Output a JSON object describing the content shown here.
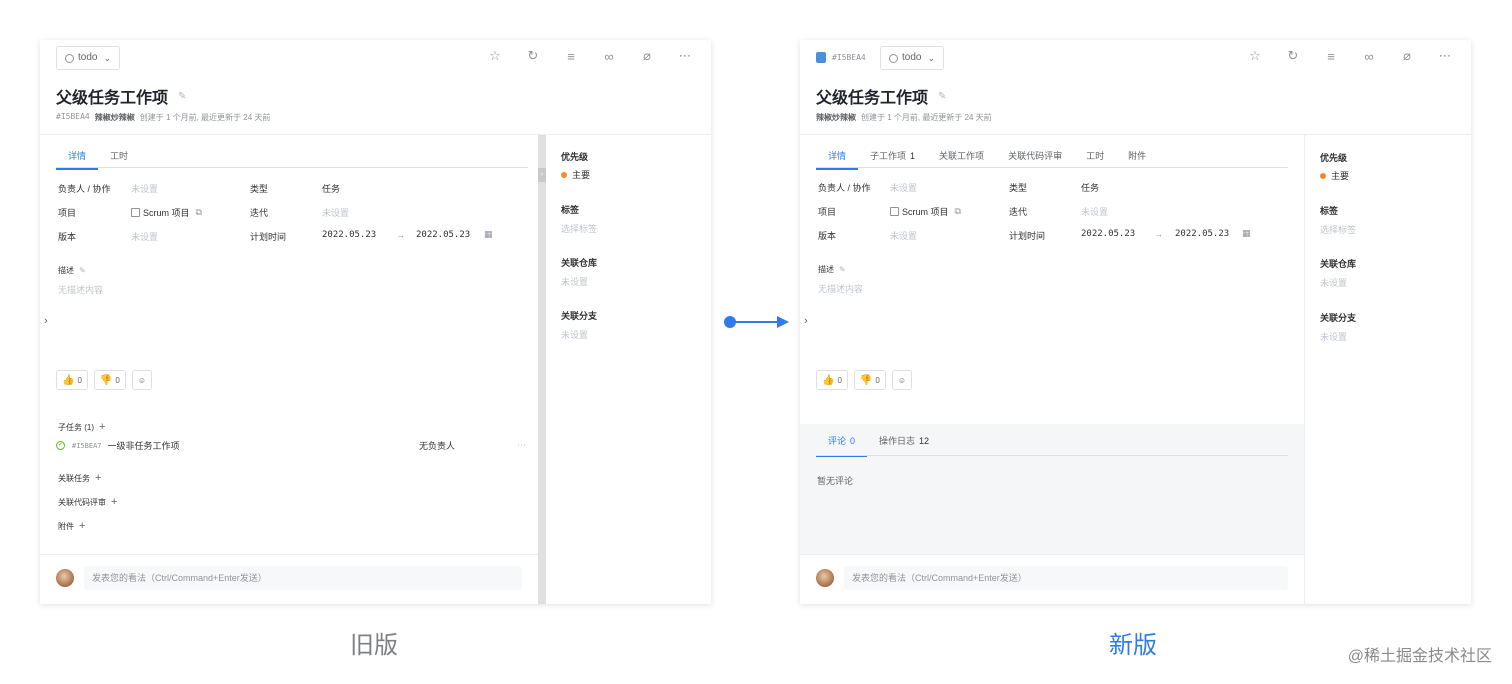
{
  "old": {
    "status": "todo",
    "title": "父级任务工作项",
    "meta": {
      "id": "#I5BEA4",
      "author": "辣椒炒辣椒",
      "info": "创建于 1 个月前, 最近更新于 24 天前"
    },
    "tabs": [
      "详情",
      "工时"
    ],
    "fields": {
      "assignee_label": "负责人 / 协作",
      "assignee_value": "未设置",
      "type_label": "类型",
      "type_value": "任务",
      "project_label": "项目",
      "project_value": "Scrum 项目",
      "iteration_label": "迭代",
      "iteration_value": "未设置",
      "version_label": "版本",
      "version_value": "未设置",
      "plan_label": "计划时间",
      "plan_start": "2022.05.23",
      "plan_arrow": "→",
      "plan_end": "2022.05.23"
    },
    "desc_label": "描述",
    "desc_value": "无描述内容",
    "likes": "0",
    "dislikes": "0",
    "subtasks_label": "子任务 (1)",
    "subtask": {
      "id": "#I5BEA7",
      "title": "一级非任务工作项",
      "assignee": "无负责人"
    },
    "related_tasks": "关联任务",
    "related_review": "关联代码评审",
    "attachments": "附件",
    "comment_placeholder": "发表您的看法（Ctrl/Command+Enter发送）",
    "side": {
      "priority_label": "优先级",
      "priority_value": "主要",
      "tags_label": "标签",
      "tags_value": "选择标签",
      "repo_label": "关联仓库",
      "repo_value": "未设置",
      "branch_label": "关联分支",
      "branch_value": "未设置"
    },
    "caption": "旧版"
  },
  "new": {
    "id_tag": "#I5BEA4",
    "status": "todo",
    "title": "父级任务工作项",
    "meta": {
      "author": "辣椒炒辣椒",
      "info": "创建于 1 个月前, 最近更新于 24 天前"
    },
    "tabs": [
      {
        "label": "详情",
        "count": ""
      },
      {
        "label": "子工作项",
        "count": "1"
      },
      {
        "label": "关联工作项",
        "count": ""
      },
      {
        "label": "关联代码评审",
        "count": ""
      },
      {
        "label": "工时",
        "count": ""
      },
      {
        "label": "附件",
        "count": ""
      }
    ],
    "fields": {
      "assignee_label": "负责人 / 协作",
      "assignee_value": "未设置",
      "type_label": "类型",
      "type_value": "任务",
      "project_label": "项目",
      "project_value": "Scrum 项目",
      "iteration_label": "迭代",
      "iteration_value": "未设置",
      "version_label": "版本",
      "version_value": "未设置",
      "plan_label": "计划时间",
      "plan_start": "2022.05.23",
      "plan_arrow": "→",
      "plan_end": "2022.05.23"
    },
    "desc_label": "描述",
    "desc_value": "无描述内容",
    "likes": "0",
    "dislikes": "0",
    "comment_tabs": [
      {
        "label": "评论",
        "count": "0"
      },
      {
        "label": "操作日志",
        "count": "12"
      }
    ],
    "no_comment": "暂无评论",
    "comment_placeholder": "发表您的看法（Ctrl/Command+Enter发送）",
    "side": {
      "priority_label": "优先级",
      "priority_value": "主要",
      "tags_label": "标签",
      "tags_value": "选择标签",
      "repo_label": "关联仓库",
      "repo_value": "未设置",
      "branch_label": "关联分支",
      "branch_value": "未设置"
    },
    "caption": "新版"
  },
  "colors": {
    "accent": "#2f7ce8",
    "priority": "#f5892e",
    "success": "#52c41a"
  },
  "icons": [
    "star-icon",
    "refresh-icon",
    "filter-icon",
    "link-icon",
    "paperclip-icon",
    "more-icon",
    "edit-icon",
    "calendar-icon",
    "thumbs-up-icon",
    "thumbs-down-icon",
    "emoji-icon"
  ],
  "watermark": "@稀土掘金技术社区"
}
